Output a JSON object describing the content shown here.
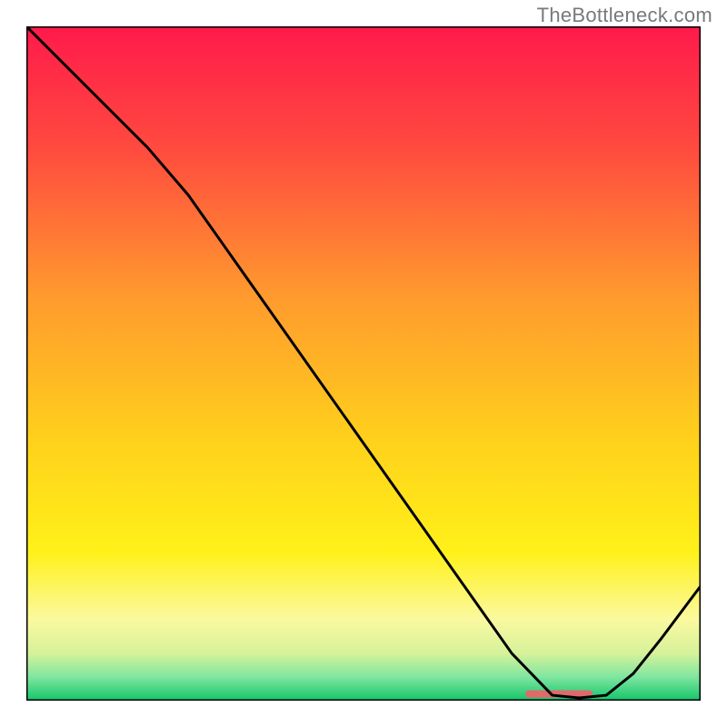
{
  "attribution": "TheBottleneck.com",
  "chart_data": {
    "type": "line",
    "title": "",
    "xlabel": "",
    "ylabel": "",
    "xlim": [
      0,
      100
    ],
    "ylim": [
      0,
      100
    ],
    "series": [
      {
        "name": "curve",
        "x": [
          0,
          6,
          12,
          18,
          24,
          30,
          36,
          42,
          48,
          54,
          60,
          66,
          72,
          78,
          82,
          86,
          90,
          94,
          100
        ],
        "y": [
          100,
          94,
          88,
          82,
          75,
          66.5,
          58,
          49.5,
          41,
          32.5,
          24,
          15.5,
          7,
          0.8,
          0.4,
          0.8,
          4,
          9,
          17
        ]
      }
    ],
    "marker_band": {
      "x_start": 74,
      "x_end": 84,
      "y": 1.0
    },
    "gradient_stops": [
      {
        "offset": 0.0,
        "color": "#ff1a4b"
      },
      {
        "offset": 0.18,
        "color": "#ff4a3f"
      },
      {
        "offset": 0.4,
        "color": "#ff9a2e"
      },
      {
        "offset": 0.62,
        "color": "#ffd21b"
      },
      {
        "offset": 0.78,
        "color": "#fff11a"
      },
      {
        "offset": 0.88,
        "color": "#fbf9a0"
      },
      {
        "offset": 0.93,
        "color": "#d6f29a"
      },
      {
        "offset": 0.965,
        "color": "#7fe6a0"
      },
      {
        "offset": 1.0,
        "color": "#13c56a"
      }
    ],
    "legend": null,
    "grid": false
  }
}
